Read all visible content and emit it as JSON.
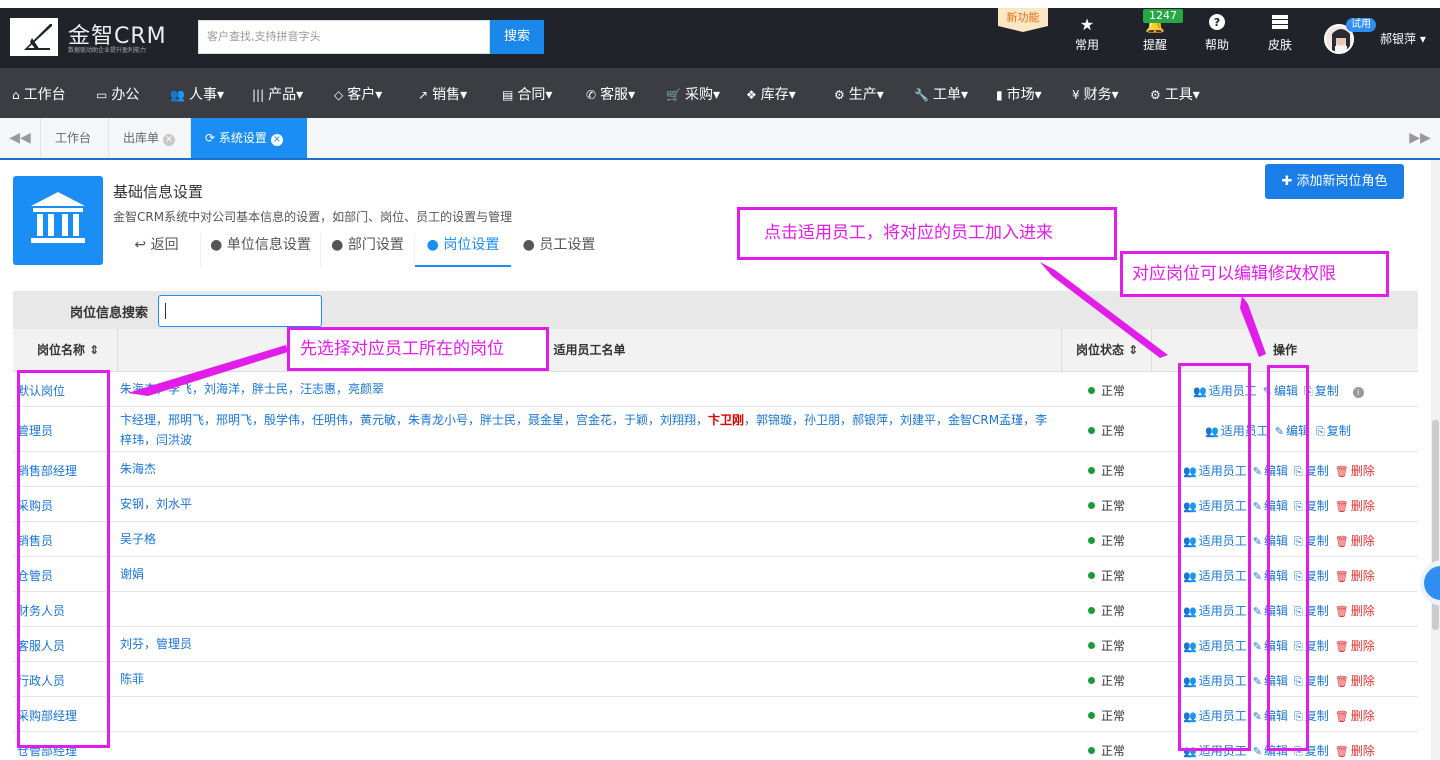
{
  "header": {
    "logo_name": "金智CRM",
    "logo_tagline": "数据驱动助企业提升盈利能力",
    "search_placeholder": "客户查找,支持拼音字头",
    "search_button": "搜索",
    "new_feature": "新功能",
    "tools": [
      {
        "label": "常用",
        "icon": "star-icon"
      },
      {
        "label": "提醒",
        "icon": "bell-icon"
      },
      {
        "label": "帮助",
        "icon": "help-icon"
      },
      {
        "label": "皮肤",
        "icon": "skin-icon"
      }
    ],
    "reminder_count": "1247",
    "trial_badge": "试用",
    "username": "郝银萍"
  },
  "menu": [
    "工作台",
    "办公",
    "人事",
    "产品",
    "客户",
    "销售",
    "合同",
    "客服",
    "采购",
    "库存",
    "生产",
    "工单",
    "市场",
    "财务",
    "工具"
  ],
  "tabs": [
    {
      "label": "工作台"
    },
    {
      "label": "出库单"
    },
    {
      "label": "系统设置"
    }
  ],
  "section": {
    "title": "基础信息设置",
    "desc": "金智CRM系统中对公司基本信息的设置，如部门、岗位、员工的设置与管理",
    "back": "返回",
    "subnav": [
      "单位信息设置",
      "部门设置",
      "岗位设置",
      "员工设置"
    ],
    "add_button": "添加新岗位角色"
  },
  "search": {
    "label": "岗位信息搜索"
  },
  "table": {
    "headers": [
      "岗位名称",
      "适用员工名单",
      "岗位状态",
      "操作"
    ],
    "ops": {
      "staff": "适用员工",
      "edit": "编辑",
      "copy": "复制",
      "delete": "删除"
    },
    "rows": [
      {
        "name": "默认岗位",
        "emps": "朱海杰，李飞，刘海洋，胖士民，汪志惠，亮颜翠",
        "status": "正常"
      },
      {
        "name": "管理员",
        "emps_pre": "卞经理，邢明飞，邢明飞，殷学伟，任明伟，黄元敏，朱青龙小号，胖士民，聂金星，宫金花，于颖，刘翔翔，",
        "emps_hl": "卞卫刚",
        "emps_post": "，郭锦璇，孙卫朋，郝银萍，刘建平，金智CRM孟瑾，李梓玮，闫洪波",
        "status": "正常"
      },
      {
        "name": "销售部经理",
        "emps": "朱海杰",
        "status": "正常"
      },
      {
        "name": "采购员",
        "emps": "安钢，刘水平",
        "status": "正常"
      },
      {
        "name": "销售员",
        "emps": "吴子格",
        "status": "正常"
      },
      {
        "name": "仓管员",
        "emps": "谢娟",
        "status": "正常"
      },
      {
        "name": "财务人员",
        "emps": "",
        "status": "正常"
      },
      {
        "name": "客服人员",
        "emps": "刘芬，管理员",
        "status": "正常"
      },
      {
        "name": "行政人员",
        "emps": "陈菲",
        "status": "正常"
      },
      {
        "name": "采购部经理",
        "emps": "",
        "status": "正常"
      },
      {
        "name": "仓管部经理",
        "emps": "",
        "status": "正常"
      }
    ]
  },
  "annotations": {
    "a1": "点击适用员工，将对应的员工加入进来",
    "a2": "对应岗位可以编辑修改权限",
    "a3": "先选择对应员工所在的岗位"
  },
  "colors": {
    "accent": "#1b8ef5",
    "annotation": "#e21de9",
    "topbar": "#20232a",
    "menubar": "#3b3d42"
  }
}
